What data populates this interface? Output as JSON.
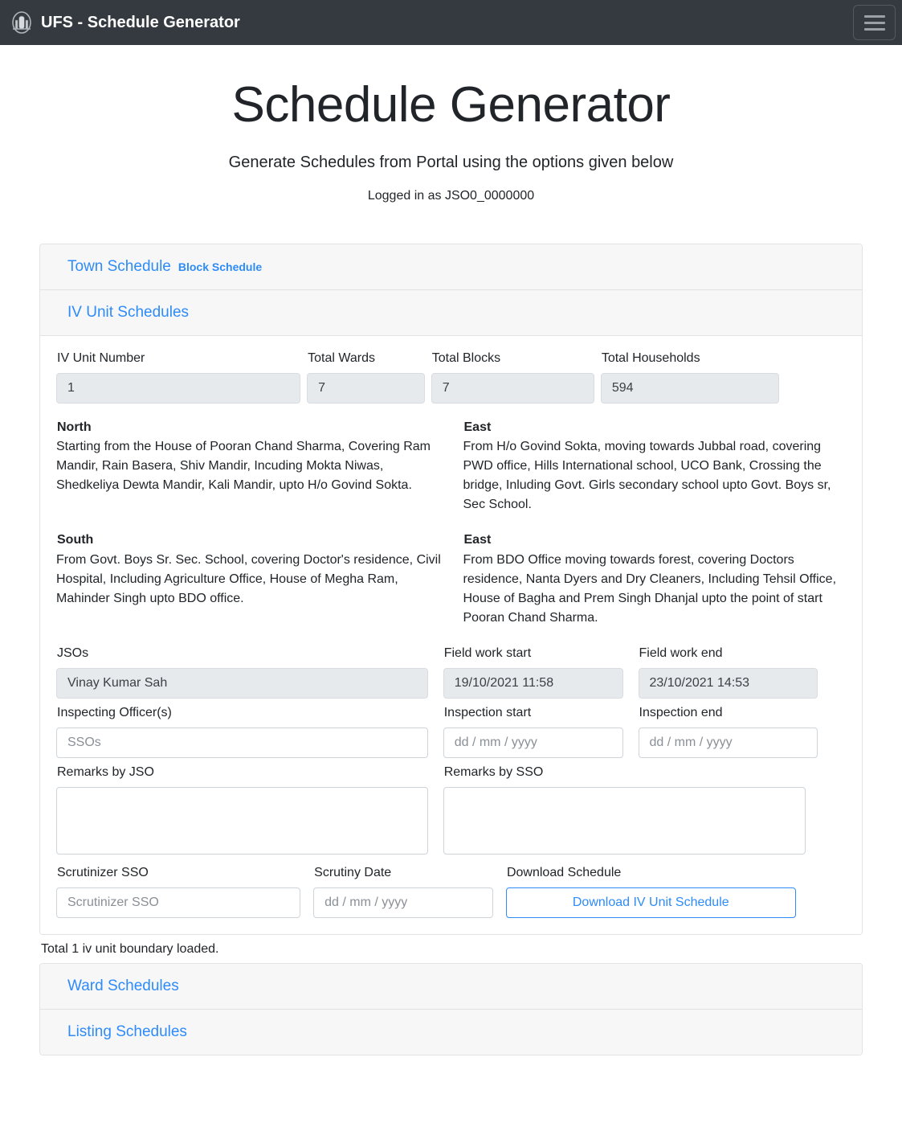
{
  "navbar": {
    "brand": "UFS - Schedule Generator",
    "logo_icon": "emblem-icon",
    "toggler_icon": "hamburger-icon"
  },
  "header": {
    "title": "Schedule Generator",
    "subtitle": "Generate Schedules from Portal using the options given below",
    "logged_in_as": "Logged in as JSO0_0000000"
  },
  "tabs": {
    "town_schedule": "Town Schedule",
    "block_schedule": "Block Schedule",
    "iv_unit_schedules": "IV Unit Schedules"
  },
  "summary": {
    "iv_unit_number_label": "IV Unit Number",
    "iv_unit_number_value": "1",
    "total_wards_label": "Total Wards",
    "total_wards_value": "7",
    "total_blocks_label": "Total Blocks",
    "total_blocks_value": "7",
    "total_households_label": "Total Households",
    "total_households_value": "594"
  },
  "boundaries": [
    {
      "direction": "North",
      "text": "Starting from the House of Pooran Chand Sharma, Covering Ram Mandir, Rain Basera, Shiv Mandir, Incuding Mokta Niwas, Shedkeliya Dewta Mandir, Kali Mandir, upto H/o Govind Sokta."
    },
    {
      "direction": "East",
      "text": "From H/o Govind Sokta, moving towards Jubbal road, covering PWD office, Hills International school, UCO Bank, Crossing the bridge, Inluding Govt. Girls secondary school upto Govt. Boys sr, Sec School."
    },
    {
      "direction": "South",
      "text": "From Govt. Boys Sr. Sec. School, covering Doctor's residence, Civil Hospital, Including Agriculture Office, House of Megha Ram, Mahinder Singh upto BDO office."
    },
    {
      "direction": "East",
      "text": "From BDO Office moving towards forest, covering Doctors residence, Nanta Dyers and Dry Cleaners, Including Tehsil Office, House of Bagha and Prem Singh Dhanjal upto the point of start Pooran Chand Sharma."
    }
  ],
  "fields": {
    "jsos_label": "JSOs",
    "jsos_value": "Vinay Kumar Sah",
    "field_work_start_label": "Field work start",
    "field_work_start_value": "19/10/2021 11:58",
    "field_work_end_label": "Field work end",
    "field_work_end_value": "23/10/2021 14:53",
    "inspecting_officers_label": "Inspecting Officer(s)",
    "inspecting_officers_placeholder": "SSOs",
    "inspecting_officers_value": "",
    "inspection_start_label": "Inspection start",
    "inspection_start_placeholder": "dd / mm / yyyy",
    "inspection_end_label": "Inspection end",
    "inspection_end_placeholder": "dd / mm / yyyy",
    "remarks_jso_label": "Remarks by JSO",
    "remarks_jso_value": "",
    "remarks_sso_label": "Remarks by SSO",
    "remarks_sso_value": "",
    "scrutinizer_sso_label": "Scrutinizer SSO",
    "scrutinizer_sso_placeholder": "Scrutinizer SSO",
    "scrutinizer_sso_value": "",
    "scrutiny_date_label": "Scrutiny Date",
    "scrutiny_date_placeholder": "dd / mm / yyyy",
    "download_schedule_label": "Download Schedule",
    "download_button": "Download IV Unit Schedule"
  },
  "status": {
    "boundary_loaded": "Total 1 iv unit boundary loaded."
  },
  "footer_sections": {
    "ward_schedules": "Ward Schedules",
    "listing_schedules": "Listing Schedules"
  },
  "colors": {
    "navbar_bg": "#343a40",
    "link_blue": "#2e8bf7",
    "card_header_bg": "#f7f7f8",
    "disabled_input_bg": "#e7eaed"
  }
}
